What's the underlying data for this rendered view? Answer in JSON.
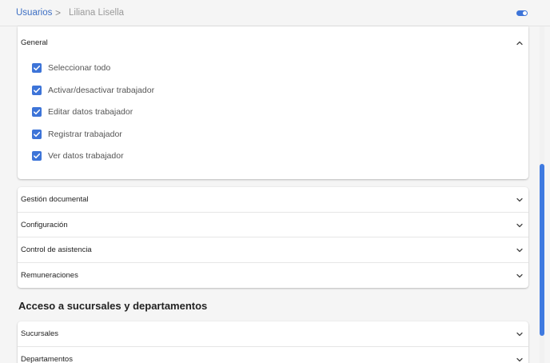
{
  "breadcrumb": {
    "root": "Usuarios",
    "separator": ">",
    "current": "Liliana Lisella"
  },
  "toggle": {
    "state": "on",
    "color": "#3d74d8"
  },
  "general": {
    "title": "General",
    "expanded": true,
    "items": [
      {
        "label": "Seleccionar todo",
        "checked": true
      },
      {
        "label": "Activar/desactivar trabajador",
        "checked": true
      },
      {
        "label": "Editar datos trabajador",
        "checked": true
      },
      {
        "label": "Registrar trabajador",
        "checked": true
      },
      {
        "label": "Ver datos trabajador",
        "checked": true
      }
    ]
  },
  "modules": [
    {
      "label": "Gestión documental"
    },
    {
      "label": "Configuración"
    },
    {
      "label": "Control de asistencia"
    },
    {
      "label": "Remuneraciones"
    }
  ],
  "access": {
    "title": "Acceso a sucursales y departamentos",
    "items": [
      {
        "label": "Sucursales"
      },
      {
        "label": "Departamentos"
      }
    ]
  },
  "icons": {
    "breadcrumb_separator": "chevron-right-icon",
    "expand": "chevron-down-icon",
    "collapse": "chevron-up-icon",
    "check": "check-icon"
  },
  "colors": {
    "accent": "#3d74d8",
    "link": "#3d6fc4",
    "scrollbar": "#3f7ae0"
  }
}
